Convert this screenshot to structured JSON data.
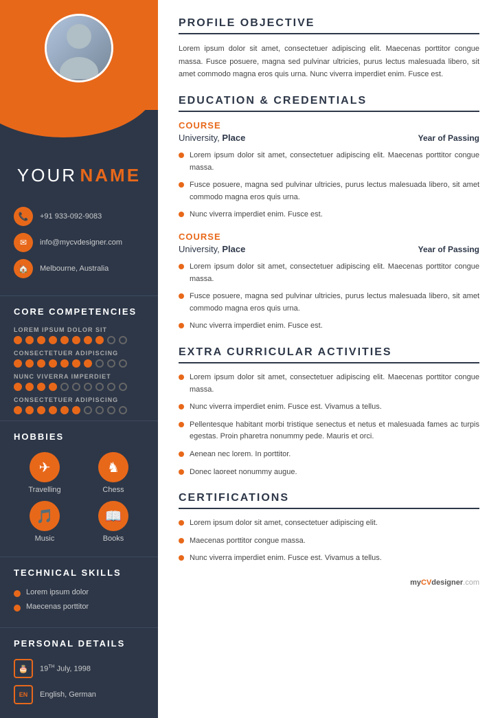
{
  "sidebar": {
    "name_first": "YOUR",
    "name_last": "NAME",
    "contact": {
      "phone": "+91 933-092-9083",
      "email": "info@mycvdesigner.com",
      "location": "Melbourne, Australia"
    },
    "core_competencies": {
      "title": "CORE COMPETENCIES",
      "items": [
        {
          "label": "LOREM IPSUM DOLOR SIT",
          "filled": 8,
          "empty": 2
        },
        {
          "label": "CONSECTETUER ADIPISCING",
          "filled": 7,
          "empty": 3
        },
        {
          "label": "NUNC VIVERRA IMPERDIET",
          "filled": 5,
          "empty": 5
        },
        {
          "label": "CONSECTETUER ADIPISCING",
          "filled": 6,
          "empty": 4
        }
      ]
    },
    "hobbies": {
      "title": "HOBBIES",
      "items": [
        {
          "label": "Travelling",
          "icon": "✈"
        },
        {
          "label": "Chess",
          "icon": "♞"
        },
        {
          "label": "Music",
          "icon": "🎵"
        },
        {
          "label": "Books",
          "icon": "📖"
        }
      ]
    },
    "technical_skills": {
      "title": "TECHNICAL SKILLS",
      "items": [
        "Lorem ipsum dolor",
        "Maecenas porttitor"
      ]
    },
    "personal_details": {
      "title": "PERSONAL DETAILS",
      "dob": "19TH July, 1998",
      "languages": "English, German"
    }
  },
  "main": {
    "profile_objective": {
      "title": "PROFILE OBJECTIVE",
      "text": "Lorem ipsum dolor sit amet, consectetuer adipiscing elit. Maecenas porttitor congue massa. Fusce posuere, magna sed pulvinar ultricies, purus lectus malesuada libero, sit amet commodo magna eros quis urna. Nunc viverra imperdiet enim. Fusce est."
    },
    "education": {
      "title": "EDUCATION & CREDENTIALS",
      "courses": [
        {
          "course_label": "COURSE",
          "university": "University,",
          "place": "Place",
          "year": "Year of Passing",
          "bullets": [
            "Lorem ipsum dolor sit amet, consectetuer adipiscing elit. Maecenas porttitor congue massa.",
            "Fusce posuere, magna sed pulvinar ultricies, purus lectus malesuada libero, sit amet commodo magna eros quis urna.",
            "Nunc viverra imperdiet enim. Fusce est."
          ]
        },
        {
          "course_label": "COURSE",
          "university": "University,",
          "place": "Place",
          "year": "Year of Passing",
          "bullets": [
            "Lorem ipsum dolor sit amet, consectetuer adipiscing elit. Maecenas porttitor congue massa.",
            "Fusce posuere, magna sed pulvinar ultricies, purus lectus malesuada libero, sit amet commodo magna eros quis urna.",
            "Nunc viverra imperdiet enim. Fusce est."
          ]
        }
      ]
    },
    "extra_curricular": {
      "title": "EXTRA CURRICULAR ACTIVITIES",
      "bullets": [
        "Lorem ipsum dolor sit amet, consectetuer adipiscing elit. Maecenas porttitor congue massa.",
        "Nunc viverra imperdiet enim. Fusce est. Vivamus a tellus.",
        "Pellentesque habitant morbi tristique senectus et netus et malesuada fames ac turpis egestas. Proin pharetra nonummy pede. Mauris et orci.",
        "Aenean nec lorem. In porttitor.",
        "Donec laoreet nonummy augue."
      ]
    },
    "certifications": {
      "title": "CERTIFICATIONS",
      "bullets": [
        "Lorem ipsum dolor sit amet, consectetuer adipiscing elit.",
        "Maecenas porttitor congue massa.",
        "Nunc viverra imperdiet enim. Fusce est. Vivamus a tellus."
      ]
    },
    "branding": {
      "my": "my",
      "cv": "CV",
      "designer": "designer",
      "com": ".com"
    }
  }
}
